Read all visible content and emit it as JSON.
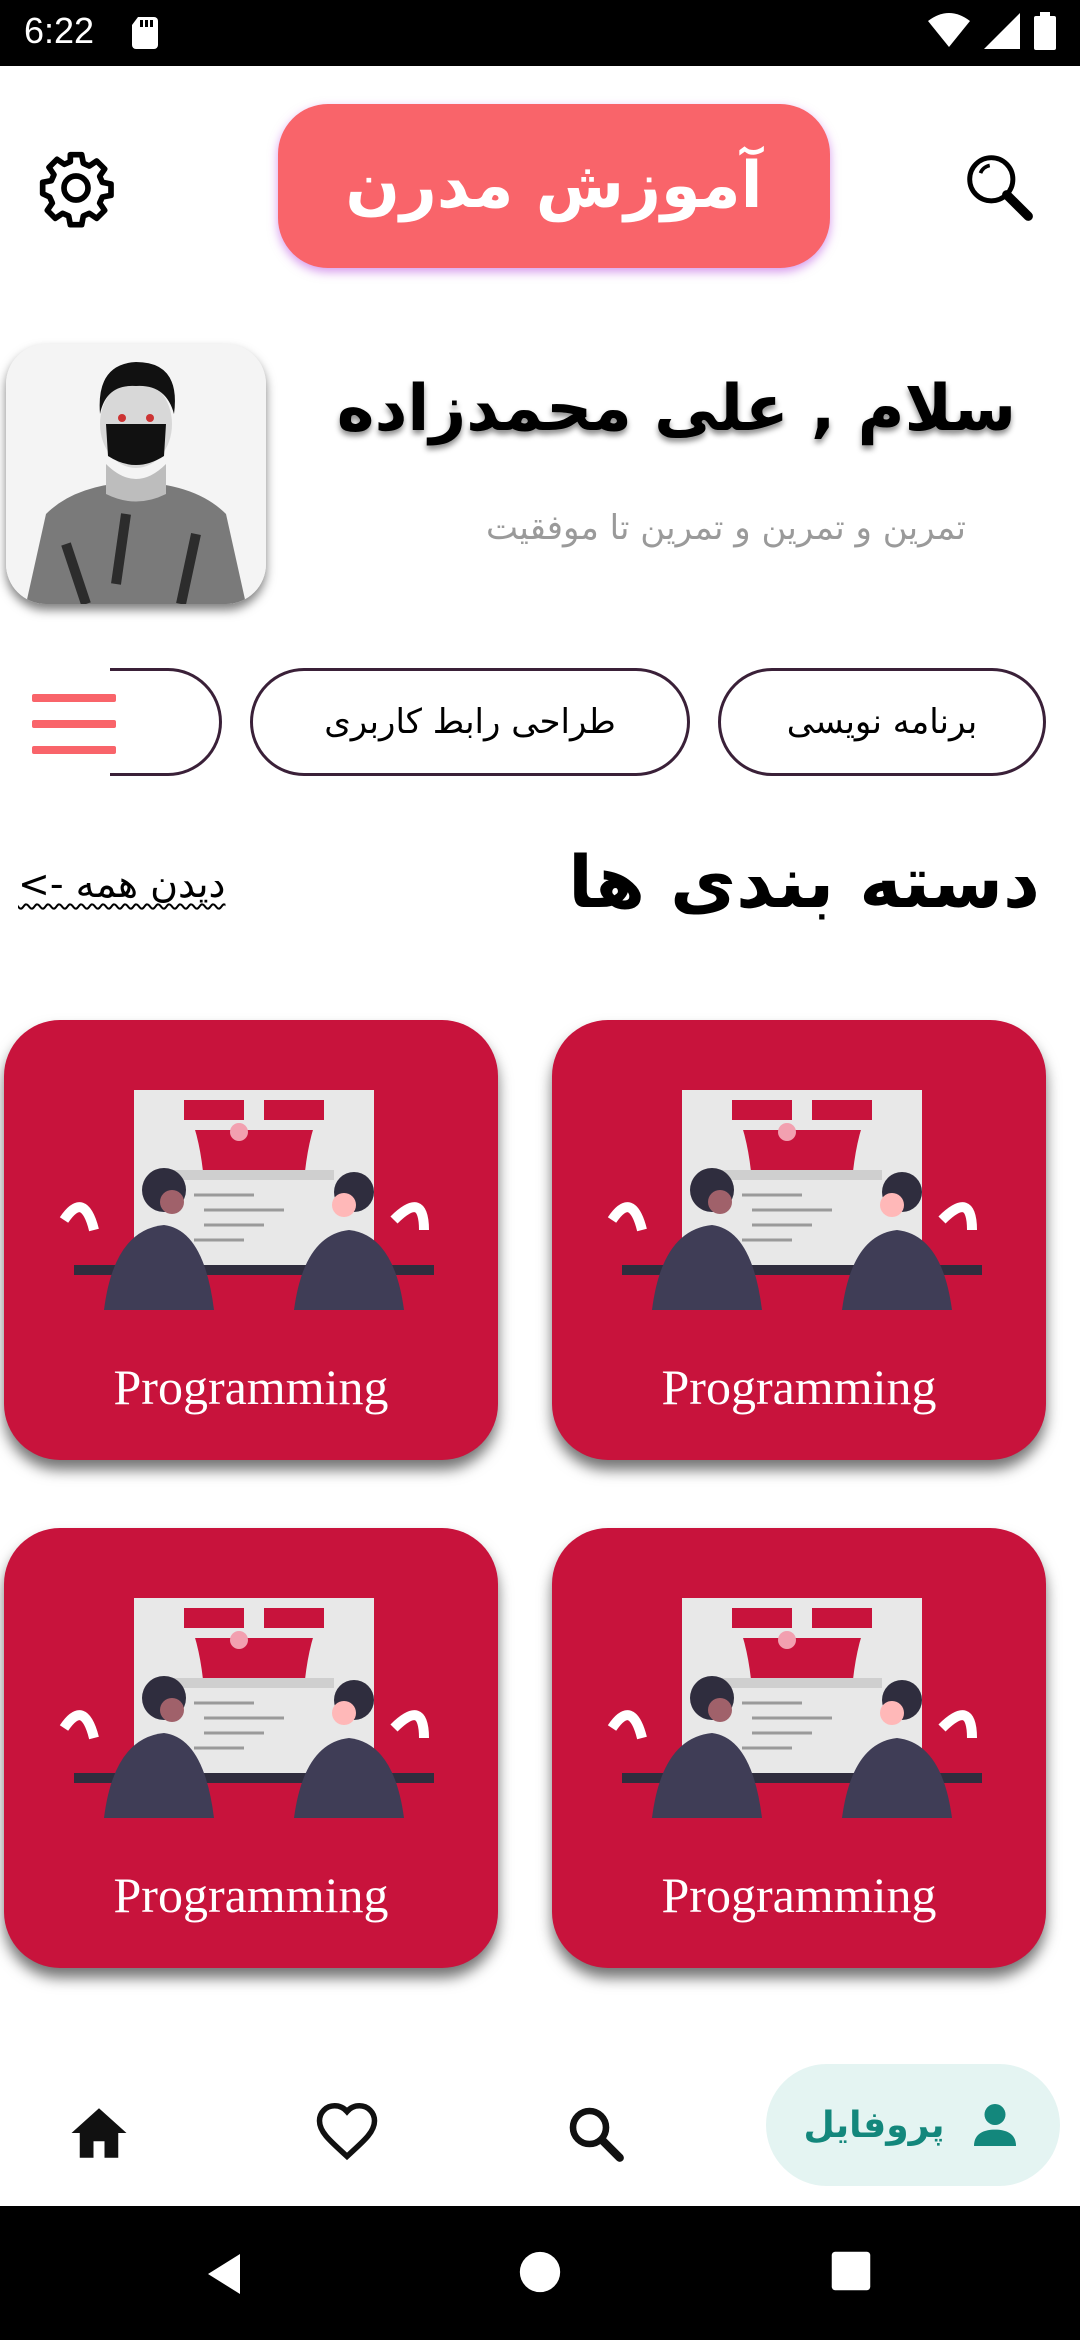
{
  "status_bar": {
    "time": "6:22"
  },
  "header": {
    "app_title": "آموزش مدرن",
    "settings_icon": "gear-icon",
    "search_icon": "search-icon",
    "accent_color": "#f9646a"
  },
  "greeting": {
    "title": "سلام , علی محمدزاده",
    "subtitle": "تمرین و تمرین و تمرین تا موفقیت"
  },
  "chips": [
    {
      "label": "برنامه نویسی"
    },
    {
      "label": "طراحی رابط کاربری"
    }
  ],
  "section": {
    "title": "دسته بندی ها",
    "see_all": "دیدن همه ->"
  },
  "cards": [
    {
      "label": "Programming"
    },
    {
      "label": "Programming"
    },
    {
      "label": "Programming"
    },
    {
      "label": "Programming"
    }
  ],
  "card_color": "#c8133c",
  "bottom_nav": {
    "profile_label": "پروفایل",
    "active_color": "#13877c"
  }
}
